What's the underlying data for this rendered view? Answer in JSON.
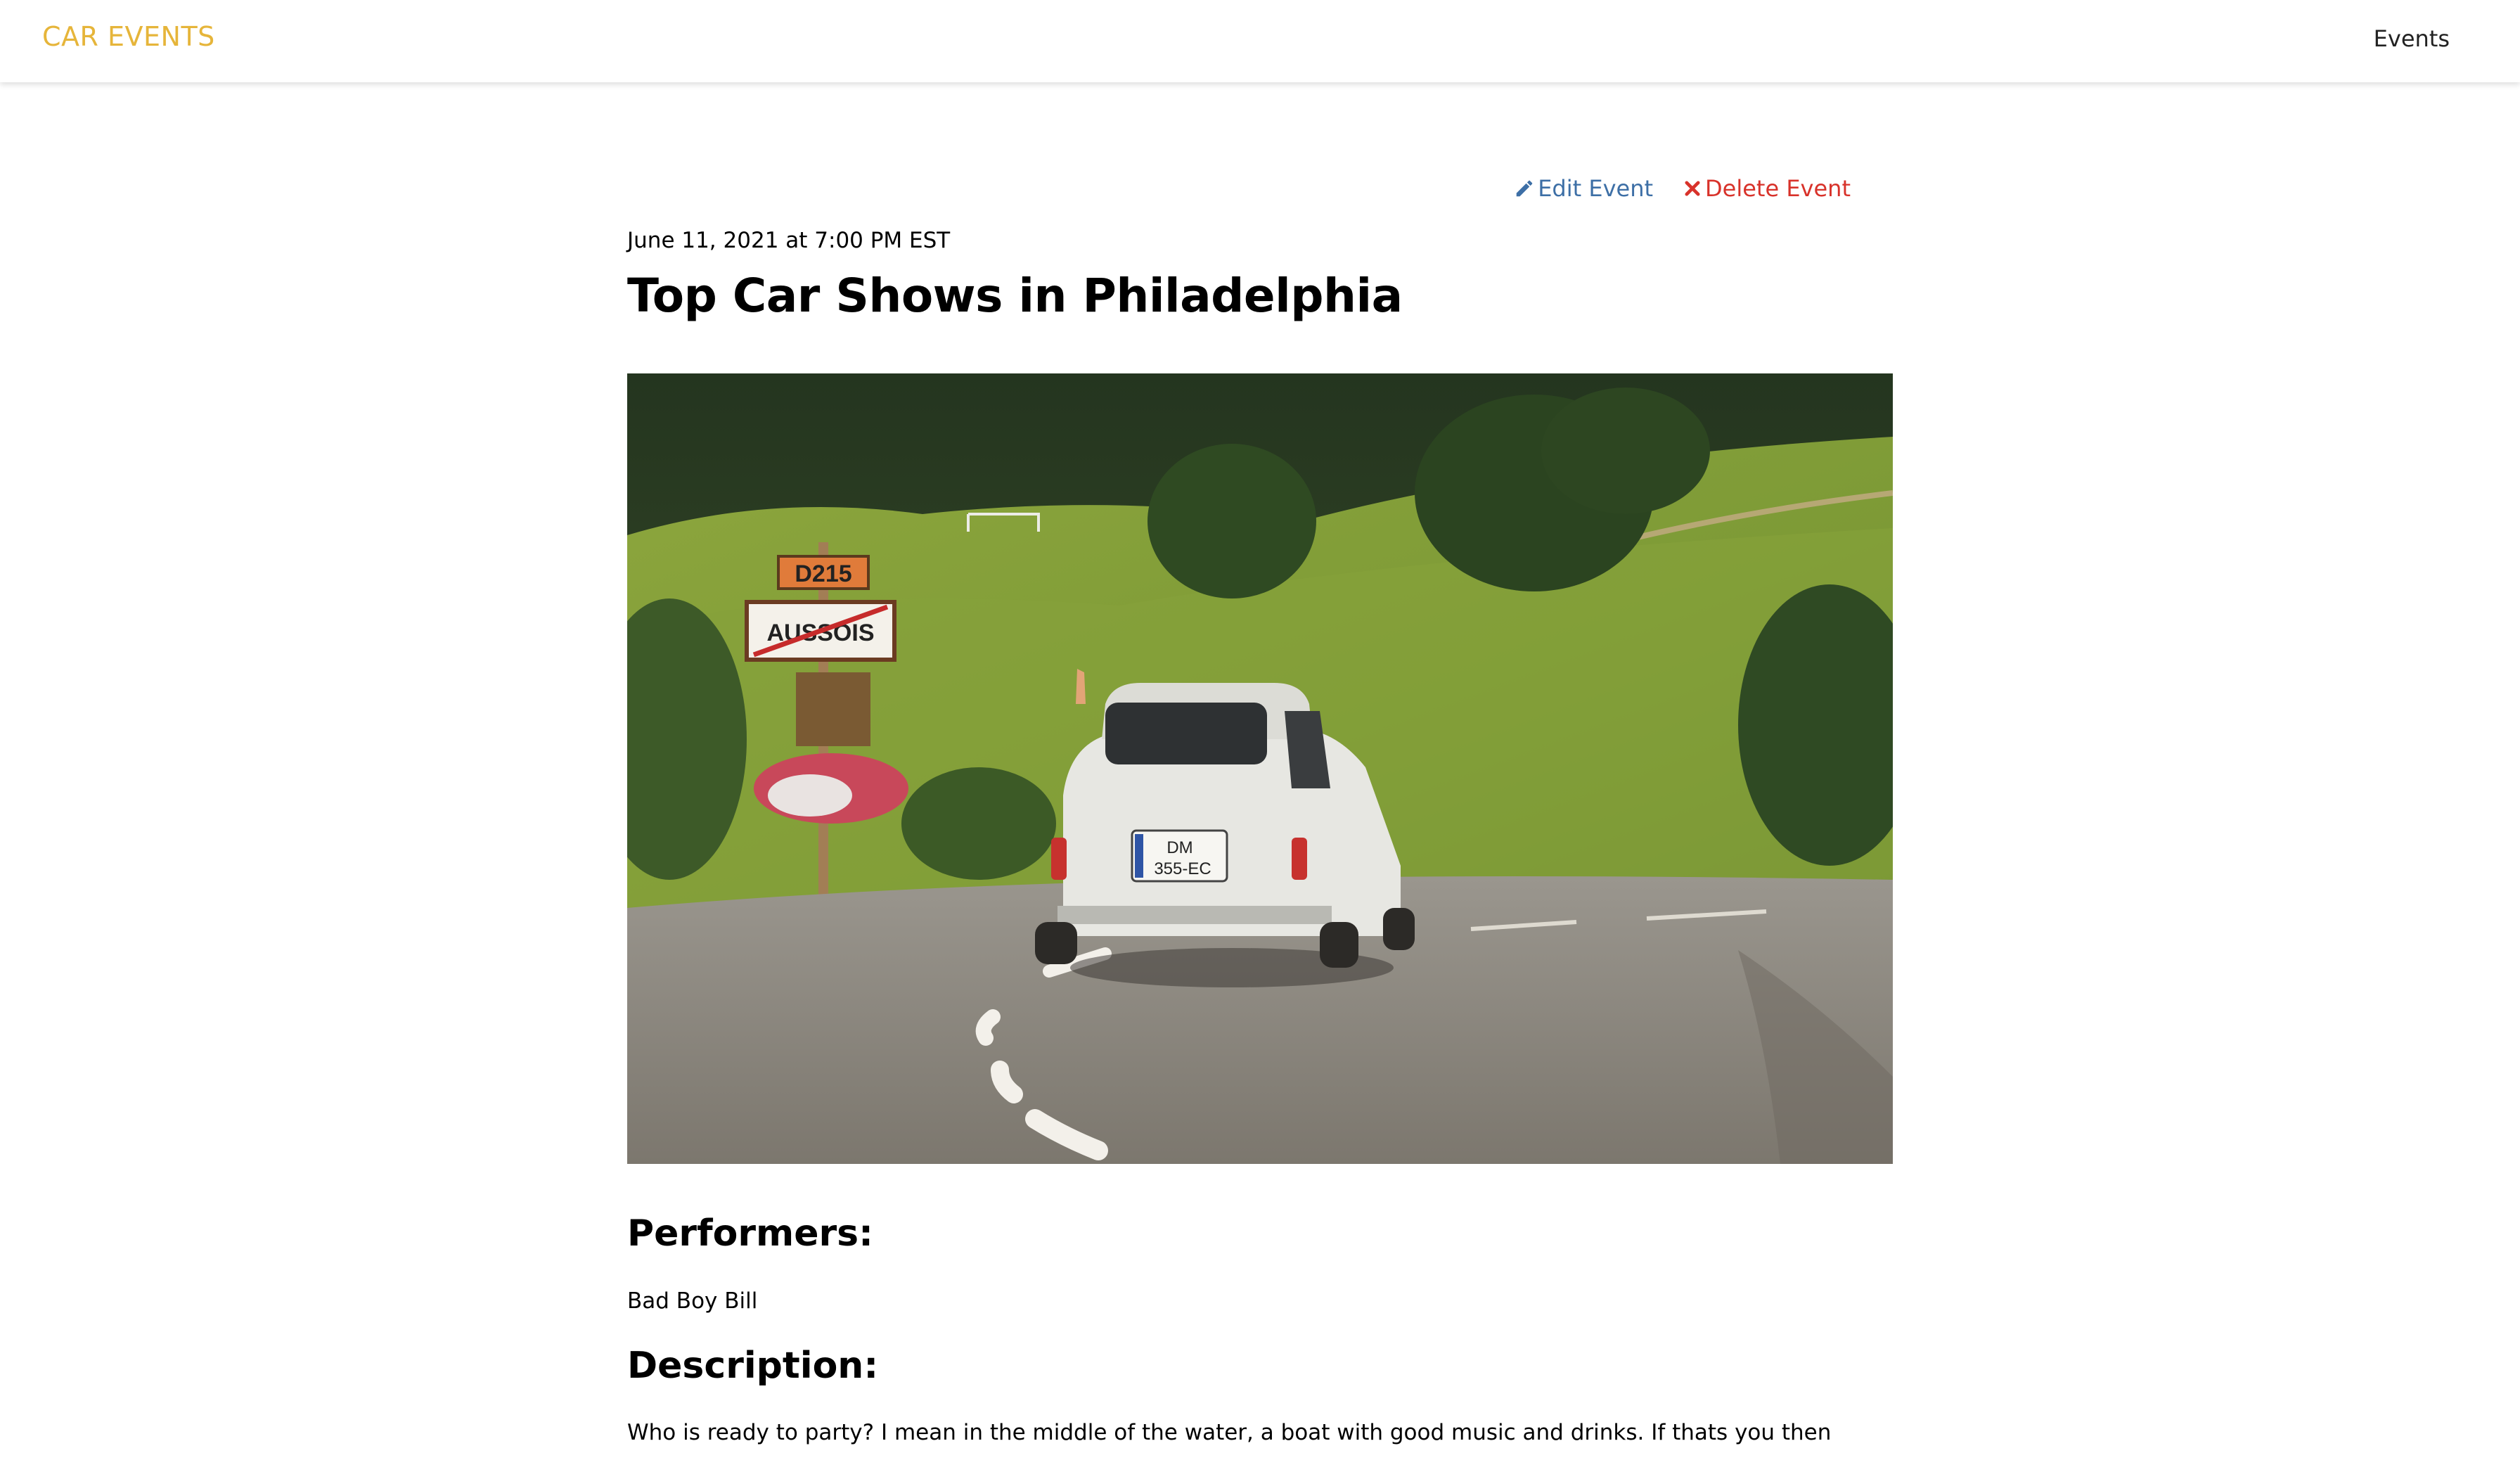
{
  "navbar": {
    "brand": "CAR EVENTS",
    "events_link": "Events"
  },
  "event": {
    "actions": {
      "edit_label": "Edit Event",
      "delete_label": "Delete Event",
      "edit_icon": "pencil-icon",
      "delete_icon": "x-icon"
    },
    "date": "June 11, 2021 at 7:00 PM EST",
    "title": "Top Car Shows in Philadelphia",
    "performers_heading": "Performers:",
    "performers": "Bad Boy Bill",
    "description_heading": "Description:",
    "description": "Who is ready to party? I mean in the middle of the water, a boat with good music and drinks. If thats you then",
    "image": {
      "sign_top": "D215",
      "sign_town": "AUSSOIS",
      "plate_line1": "DM",
      "plate_line2": "355-EC"
    }
  },
  "colors": {
    "brand": "#e6b53a",
    "edit": "#3d6fa6",
    "delete": "#d8322a"
  }
}
